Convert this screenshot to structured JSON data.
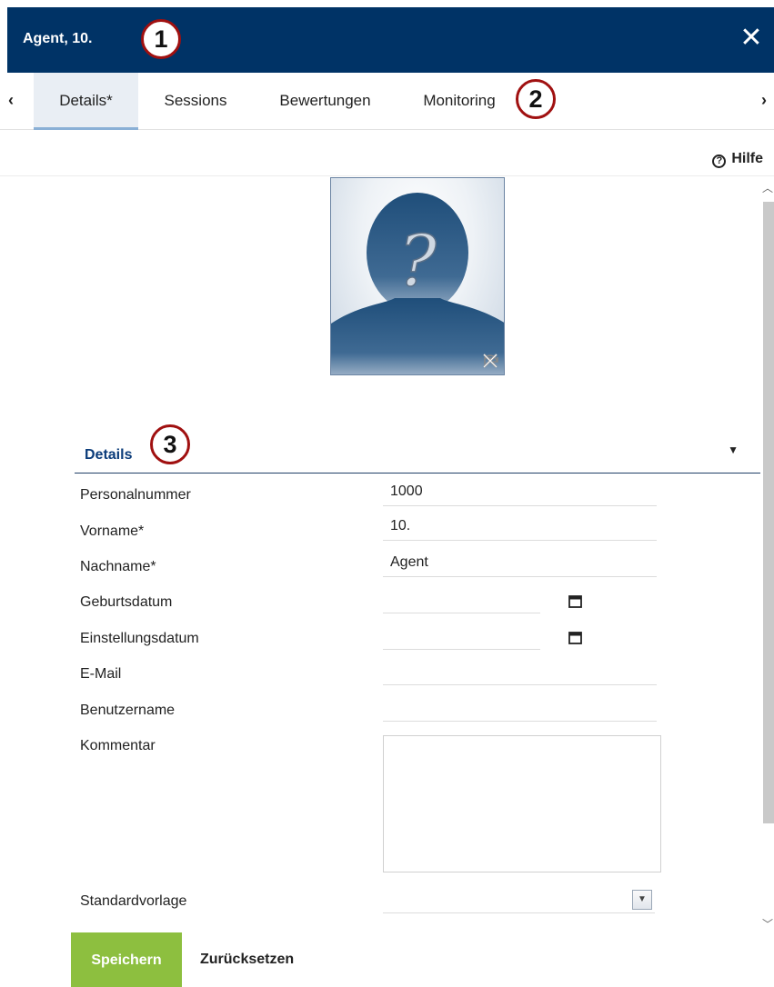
{
  "window": {
    "title": "Agent, 10.",
    "close_icon": "close-icon"
  },
  "tabs": {
    "prev_icon": "chevron-left-icon",
    "next_icon": "chevron-right-icon",
    "items": [
      {
        "label": "Details*",
        "active": true
      },
      {
        "label": "Sessions",
        "active": false
      },
      {
        "label": "Bewertungen",
        "active": false
      },
      {
        "label": "Monitoring",
        "active": false
      }
    ]
  },
  "help": {
    "label": "Hilfe",
    "icon": "help-circle-icon"
  },
  "callouts": [
    "1",
    "2",
    "3"
  ],
  "photo": {
    "placeholder_glyph": "?",
    "actions": [
      "rotate-icon",
      "remove-icon"
    ]
  },
  "section": {
    "title": "Details",
    "collapse_icon": "caret-down-icon"
  },
  "fields": {
    "personalnummer": {
      "label": "Personalnummer",
      "value": "1000"
    },
    "vorname": {
      "label": "Vorname*",
      "value": "10."
    },
    "nachname": {
      "label": "Nachname*",
      "value": "Agent"
    },
    "geburtsdatum": {
      "label": "Geburtsdatum",
      "value": ""
    },
    "einstellungsdatum": {
      "label": "Einstellungsdatum",
      "value": ""
    },
    "email": {
      "label": "E-Mail",
      "value": ""
    },
    "benutzername": {
      "label": "Benutzername",
      "value": ""
    },
    "kommentar": {
      "label": "Kommentar",
      "value": ""
    },
    "standardvorlage": {
      "label": "Standardvorlage",
      "value": ""
    }
  },
  "actions": {
    "save": "Speichern",
    "reset": "Zurücksetzen"
  },
  "colors": {
    "header": "#003366",
    "save": "#8dbf3f",
    "section": "#0b3c7a",
    "callout_border": "#a01010"
  }
}
